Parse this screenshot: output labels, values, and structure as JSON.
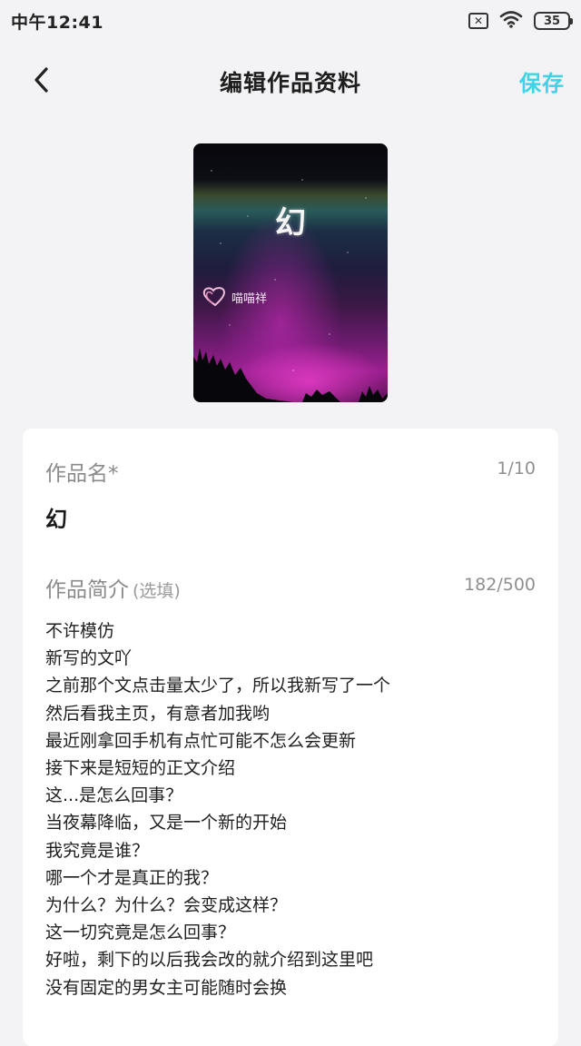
{
  "status_bar": {
    "time": "中午12:41",
    "sim_icon_label": "✕",
    "battery": "35"
  },
  "nav": {
    "title": "编辑作品资料",
    "save_label": "保存"
  },
  "colors": {
    "accent": "#3ed3e6",
    "card_background": "#ffffff",
    "page_background": "#f3f3f5"
  },
  "cover": {
    "title": "幻",
    "signature": "喵喵祥"
  },
  "work_name": {
    "label": "作品名*",
    "counter": "1/10",
    "value": "幻"
  },
  "intro": {
    "label": "作品简介",
    "optional": "(选填)",
    "counter": "182/500",
    "lines": [
      "不许模仿",
      "新写的文吖",
      "之前那个文点击量太少了，所以我新写了一个",
      "然后看我主页，有意者加我哟",
      "最近刚拿回手机有点忙可能不怎么会更新",
      "接下来是短短的正文介绍",
      "这...是怎么回事？",
      "当夜幕降临，又是一个新的开始",
      "我究竟是谁？",
      "哪一个才是真正的我？",
      "为什么？为什么？会变成这样？",
      "这一切究竟是怎么回事？",
      "好啦，剩下的以后我会改的就介绍到这里吧",
      "没有固定的男女主可能随时会换"
    ]
  }
}
